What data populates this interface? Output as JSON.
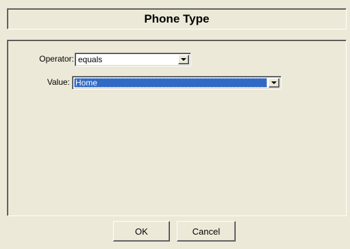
{
  "dialog": {
    "title": "Phone Type"
  },
  "form": {
    "operator": {
      "label": "Operator:",
      "value": "equals"
    },
    "value": {
      "label": "Value:",
      "value": "Home"
    }
  },
  "buttons": {
    "ok_label": "OK",
    "cancel_label": "Cancel"
  },
  "icons": {
    "dropdown": "chevron-down-icon"
  },
  "colors": {
    "dialog_background": "#ece9d8",
    "selection_highlight": "#316ac5"
  }
}
